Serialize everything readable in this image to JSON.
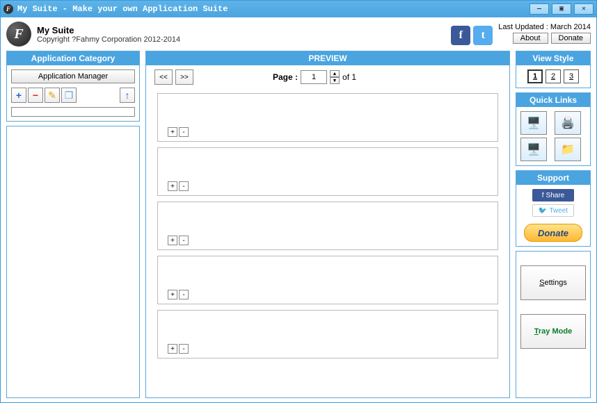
{
  "window": {
    "title": "My Suite - Make your own Application Suite",
    "min": "—",
    "max": "▣",
    "close": "✕"
  },
  "header": {
    "app_name": "My Suite",
    "copyright": "Copyright ?Fahmy Corporation 2012-2014",
    "last_updated": "Last Updated : March 2014",
    "about": "About",
    "donate": "Donate"
  },
  "sidebar": {
    "title": "Application Category",
    "manager_btn": "Application Manager",
    "icons": {
      "add": "+",
      "remove": "−",
      "edit": "✎",
      "copy": "❐",
      "up": "↑"
    }
  },
  "preview": {
    "title": "PREVIEW",
    "prev": "<<",
    "next": ">>",
    "page_label": "Page :",
    "page_value": "1",
    "of_label": "of 1",
    "slot_plus": "+",
    "slot_minus": "-"
  },
  "viewstyle": {
    "title": "View Style",
    "b1": "1",
    "b2": "2",
    "b3": "3"
  },
  "quicklinks": {
    "title": "Quick Links"
  },
  "support": {
    "title": "Support",
    "share": "Share",
    "tweet": "Tweet",
    "donate": "Donate"
  },
  "bottom": {
    "settings_pre": "S",
    "settings_post": "ettings",
    "tray_pre": "T",
    "tray_post": "ray Mode"
  }
}
